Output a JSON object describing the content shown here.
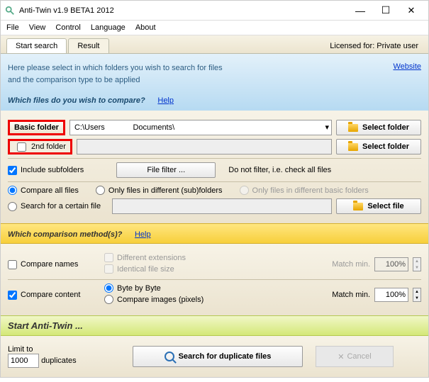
{
  "window": {
    "title": "Anti-Twin  v1.9 BETA1  2012"
  },
  "menu": [
    "File",
    "View",
    "Control",
    "Language",
    "About"
  ],
  "tabs": {
    "start": "Start search",
    "result": "Result"
  },
  "license": "Licensed for: Private user",
  "intro": {
    "line1": "Here please select in which folders you wish to search for files",
    "line2": "and the comparison type to be applied",
    "website": "Website"
  },
  "q1": {
    "title": "Which files do you wish to compare?",
    "help": "Help"
  },
  "folders": {
    "basic_label": "Basic folder",
    "basic_path": "C:\\Users             Documents\\",
    "second_label": "2nd folder",
    "second_path": "",
    "select_folder": "Select folder"
  },
  "filter": {
    "include_sub": "Include subfolders",
    "file_filter": "File filter ...",
    "no_filter": "Do not filter, i.e. check all files"
  },
  "scope": {
    "all": "Compare all files",
    "diff_sub": "Only files in different (sub)folders",
    "diff_basic": "Only files in different basic folders",
    "search_file": "Search for a certain file",
    "select_file": "Select file"
  },
  "q2": {
    "title": "Which comparison method(s)?",
    "help": "Help"
  },
  "method": {
    "compare_names": "Compare names",
    "diff_ext": "Different extensions",
    "ident_size": "Identical file size",
    "match_min": "Match min.",
    "names_pct": "100%",
    "compare_content": "Compare content",
    "byte": "Byte by Byte",
    "pixels": "Compare images (pixels)",
    "content_pct": "100%"
  },
  "q3": {
    "title": "Start Anti-Twin ..."
  },
  "run": {
    "limit_to": "Limit to",
    "limit_val": "1000",
    "duplicates": "duplicates",
    "search": "Search for duplicate files",
    "cancel": "Cancel"
  }
}
